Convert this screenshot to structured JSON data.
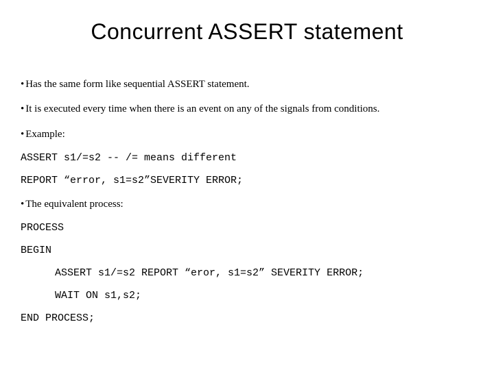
{
  "title": "Concurrent ASSERT statement",
  "bullets": {
    "b1": "Has the same form like sequential ASSERT statement.",
    "b2": "It is executed every time when there is an event on any of the signals from conditions.",
    "b3": "Example:",
    "b4": "The equivalent process:"
  },
  "code": {
    "c1": "ASSERT s1/=s2 -- /= means different",
    "c2": "REPORT “error, s1=s2”SEVERITY ERROR;",
    "c3": "PROCESS",
    "c4": "BEGIN",
    "c5": "ASSERT s1/=s2 REPORT “eror, s1=s2” SEVERITY ERROR;",
    "c6": "WAIT ON s1,s2;",
    "c7": "END PROCESS;"
  },
  "bullet_char": "•"
}
